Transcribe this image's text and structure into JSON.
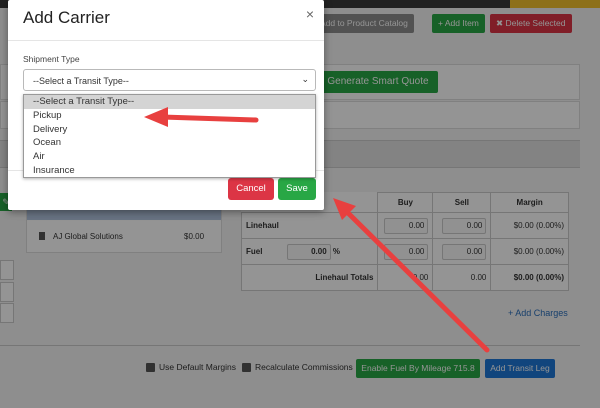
{
  "background": {
    "toolbar": {
      "add_to_catalog": "Add to Product Catalog",
      "add_item": "+ Add Item",
      "delete_selected": "✖ Delete Selected"
    },
    "generate_smart_quote": "Generate Smart Quote",
    "carrier": {
      "name": "AJ Global Solutions",
      "amount": "$0.00"
    },
    "rates": {
      "headers": {
        "buy": "Buy",
        "sell": "Sell",
        "margin": "Margin"
      },
      "linehaul": {
        "label": "Linehaul",
        "buy": "0.00",
        "sell": "0.00",
        "margin": "$0.00 (0.00%)"
      },
      "fuel": {
        "label": "Fuel",
        "percent_value": "0.00",
        "percent_sign": "%",
        "buy": "0.00",
        "sell": "0.00",
        "margin": "$0.00 (0.00%)"
      },
      "totals": {
        "label": "Linehaul Totals",
        "buy": "0.00",
        "sell": "0.00",
        "margin": "$0.00 (0.00%)"
      }
    },
    "add_charges": "+ Add Charges",
    "use_default_margins": "Use Default Margins",
    "recalculate_commissions": "Recalculate Commissions",
    "enable_fuel": "Enable Fuel By Mileage 715.8",
    "add_transit_leg": "Add Transit Leg"
  },
  "modal": {
    "title": "Add Carrier",
    "close": "×",
    "shipment_type_label": "Shipment Type",
    "select_value": "--Select a Transit Type--",
    "options": [
      "--Select a Transit Type--",
      "Pickup",
      "Delivery",
      "Ocean",
      "Air",
      "Insurance"
    ],
    "cancel": "Cancel",
    "save": "Save"
  },
  "colors": {
    "arrow": "#e8403f",
    "green": "#28a745",
    "red": "#dc3545",
    "blue": "#1e78d7"
  }
}
